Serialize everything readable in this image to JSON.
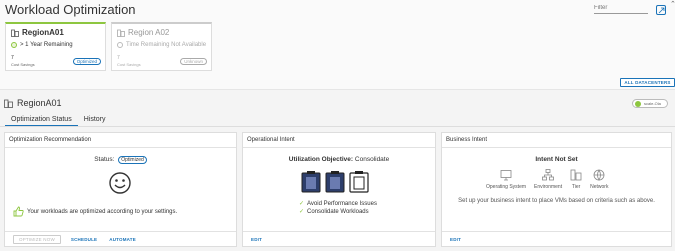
{
  "header": {
    "title": "Workload Optimization",
    "filter_placeholder": "Filter"
  },
  "regions": [
    {
      "name": "RegionA01",
      "status": "> 1 Year Remaining",
      "count": "7",
      "count_label": "Cost Savings",
      "badge": "Optimized"
    },
    {
      "name": "Region A02",
      "status": "Time Remaining Not Available",
      "count": "7",
      "count_label": "Cost Savings",
      "badge": "Unknown"
    }
  ],
  "all_datacenters_label": "ALL DATACENTERS",
  "selected_region": {
    "name": "RegionA01",
    "toggle_label": "scale-Ola"
  },
  "tabs": [
    {
      "label": "Optimization Status",
      "active": true
    },
    {
      "label": "History",
      "active": false
    }
  ],
  "optimization_card": {
    "title": "Optimization Recommendation",
    "status_label": "Status:",
    "status_value": "Optimized",
    "message": "Your workloads are optimized according to your settings.",
    "buttons": {
      "optimize_now": "OPTIMIZE NOW",
      "schedule": "SCHEDULE",
      "automate": "AUTOMATE"
    }
  },
  "operational_card": {
    "title": "Operational Intent",
    "objective_label": "Utilization Objective:",
    "objective_value": "Consolidate",
    "bullets": [
      "Avoid Performance Issues",
      "Consolidate Workloads"
    ],
    "edit_label": "EDIT"
  },
  "business_card": {
    "title": "Business Intent",
    "heading": "Intent Not Set",
    "criteria": [
      "Operating System",
      "Environment",
      "Tier",
      "Network"
    ],
    "description": "Set up your business intent to place VMs based on criteria such as above.",
    "edit_label": "EDIT"
  },
  "colors": {
    "accent": "#1a73b8",
    "ok": "#8dc63f"
  }
}
